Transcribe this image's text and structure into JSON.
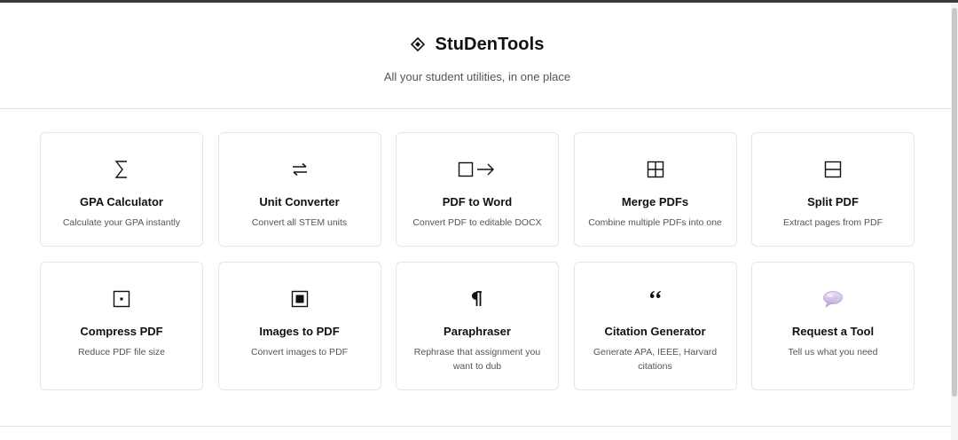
{
  "header": {
    "brand": "StuDenTools",
    "tagline": "All your student utilities, in one place",
    "logo_icon": "diamond-icon"
  },
  "tools": [
    {
      "title": "GPA Calculator",
      "desc": "Calculate your GPA instantly",
      "icon": "sigma-icon"
    },
    {
      "title": "Unit Converter",
      "desc": "Convert all STEM units",
      "icon": "swap-arrows-icon"
    },
    {
      "title": "PDF to Word",
      "desc": "Convert PDF to editable DOCX",
      "icon": "box-arrow-icon"
    },
    {
      "title": "Merge PDFs",
      "desc": "Combine multiple PDFs into one",
      "icon": "grid-square-icon"
    },
    {
      "title": "Split PDF",
      "desc": "Extract pages from PDF",
      "icon": "split-square-icon"
    },
    {
      "title": "Compress PDF",
      "desc": "Reduce PDF file size",
      "icon": "dot-square-icon"
    },
    {
      "title": "Images to PDF",
      "desc": "Convert images to PDF",
      "icon": "filled-square-icon"
    },
    {
      "title": "Paraphraser",
      "desc": "Rephrase that assignment you want to dub",
      "icon": "pilcrow-icon"
    },
    {
      "title": "Citation Generator",
      "desc": "Generate APA, IEEE, Harvard citations",
      "icon": "quote-icon"
    },
    {
      "title": "Request a Tool",
      "desc": "Tell us what you need",
      "icon": "speech-bubble-icon"
    }
  ]
}
